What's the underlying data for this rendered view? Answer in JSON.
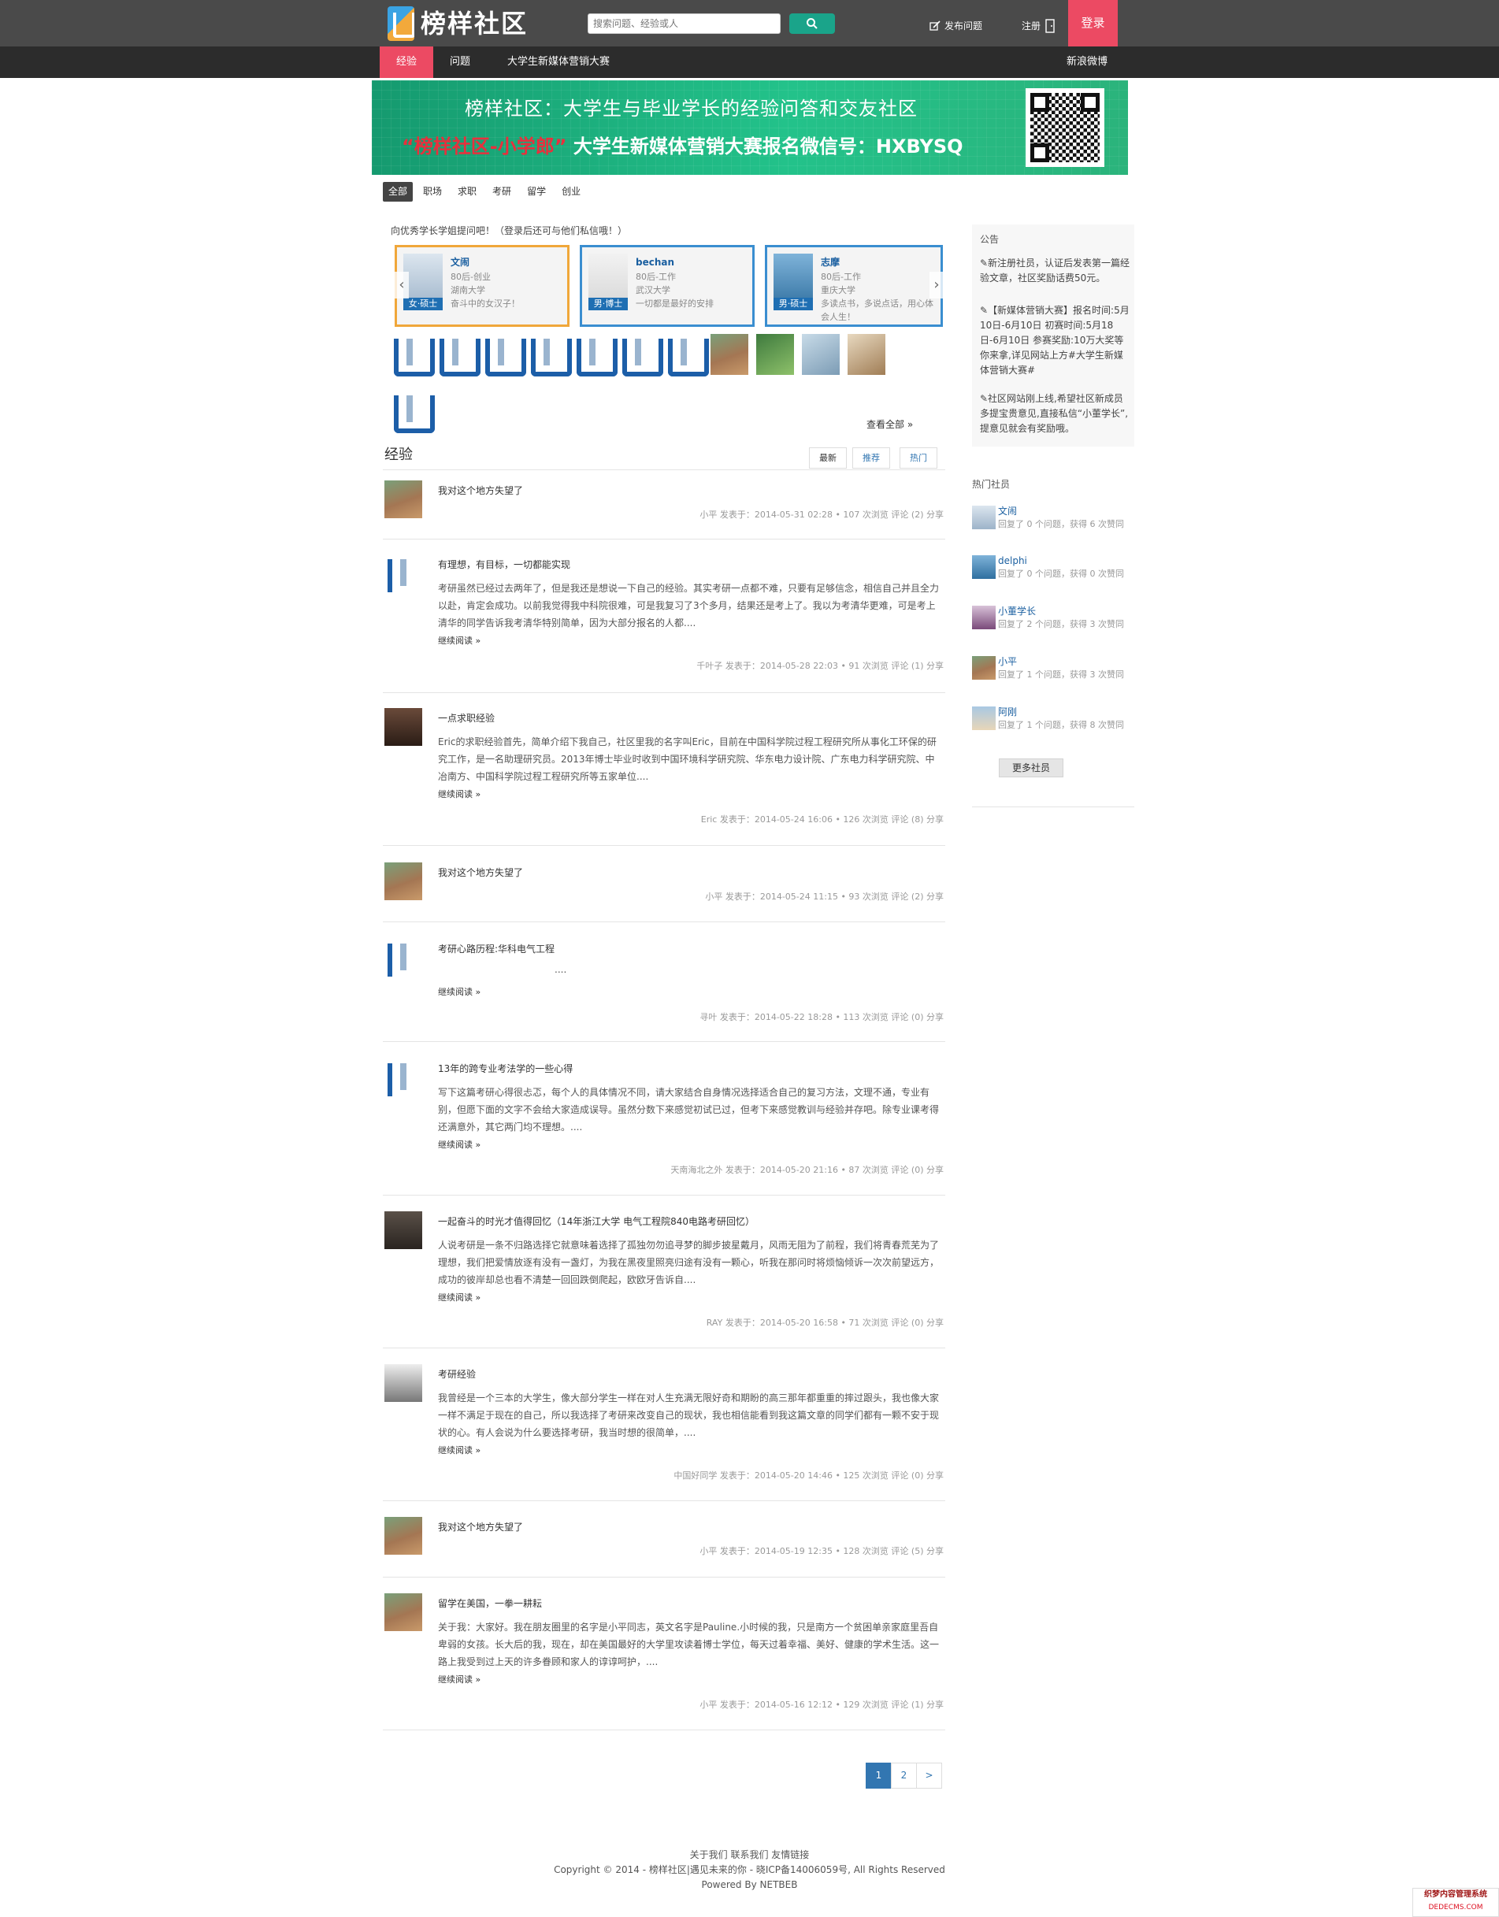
{
  "header": {
    "logo_text": "榜样社区",
    "search_placeholder": "搜索问题、经验或人",
    "ask_label": "发布问题",
    "register_label": "注册",
    "login_label": "登录"
  },
  "nav": {
    "items": [
      "经验",
      "问题",
      "大学生新媒体营销大赛"
    ],
    "right_link": "新浪微博"
  },
  "banner": {
    "line1": "榜样社区：大学生与毕业学长的经验问答和交友社区",
    "line2_red": "“榜样社区-小学郎”",
    "line2_white": "大学生新媒体营销大赛报名微信号：HXBYSQ"
  },
  "categories": [
    "全部",
    "职场",
    "求职",
    "考研",
    "留学",
    "创业"
  ],
  "ask_prompt": "向优秀学长学姐提问吧！（登录后还可与他们私信哦！）",
  "mentors": [
    {
      "name": "文闹",
      "badge": "女·硕士",
      "line1": "80后-创业",
      "line2": "湖南大学",
      "line3": "奋斗中的女汉子！",
      "color": "#f0a73a"
    },
    {
      "name": "bechan",
      "badge": "男·博士",
      "line1": "80后-工作",
      "line2": "武汉大学",
      "line3": "一切都是最好的安排",
      "color": "#3a8ed0"
    },
    {
      "name": "志摩",
      "badge": "男·硕士",
      "line1": "80后-工作",
      "line2": "重庆大学",
      "line3": "多读点书，多说点话，用心体会人生！",
      "color": "#3a8ed0"
    }
  ],
  "view_all": "查看全部 »",
  "section": {
    "title": "经验",
    "tabs": [
      "最新",
      "推荐",
      "热门"
    ]
  },
  "posts": [
    {
      "title": "我对这个地方失望了",
      "excerpt": "",
      "more": "",
      "meta": "小平 发表于：2014-05-31 02:28 • 107 次浏览 评论 (2) 分享"
    },
    {
      "title": "有理想，有目标，一切都能实现",
      "excerpt": "考研虽然已经过去两年了，但是我还是想说一下自己的经验。其实考研一点都不难，只要有足够信念，相信自己并且全力以赴，肯定会成功。以前我觉得我中科院很难，可是我复习了3个多月，结果还是考上了。我以为考清华更难，可是考上清华的同学告诉我考清华特别简单，因为大部分报名的人都....",
      "more": "继续阅读 »",
      "meta": "千叶子 发表于：2014-05-28 22:03 • 91 次浏览 评论 (1) 分享"
    },
    {
      "title": "一点求职经验",
      "excerpt": "Eric的求职经验首先，简单介绍下我自己，社区里我的名字叫Eric，目前在中国科学院过程工程研究所从事化工环保的研究工作，是一名助理研究员。2013年博士毕业时收到中国环境科学研究院、华东电力设计院、广东电力科学研究院、中冶南方、中国科学院过程工程研究所等五家单位....",
      "more": "继续阅读 »",
      "meta": "Eric 发表于：2014-05-24 16:06 • 126 次浏览 评论 (8) 分享"
    },
    {
      "title": "我对这个地方失望了",
      "excerpt": "",
      "more": "",
      "meta": "小平 发表于：2014-05-24 11:15 • 93 次浏览 评论 (2) 分享"
    },
    {
      "title": "考研心路历程:华科电气工程",
      "excerpt": "....",
      "more": "继续阅读 »",
      "meta": "寻叶 发表于：2014-05-22 18:28 • 113 次浏览 评论 (0) 分享"
    },
    {
      "title": "13年的跨专业考法学的一些心得",
      "excerpt": "写下这篇考研心得很忐忑，每个人的具体情况不同，请大家结合自身情况选择适合自己的复习方法，文理不通，专业有别，但愿下面的文字不会给大家造成误导。虽然分数下来感觉初试已过，但考下来感觉教训与经验并存吧。除专业课考得还满意外，其它两门均不理想。....",
      "more": "继续阅读 »",
      "meta": "天南海北之外 发表于：2014-05-20 21:16 • 87 次浏览 评论 (0) 分享"
    },
    {
      "title": "一起奋斗的时光才值得回忆（14年浙江大学 电气工程院840电路考研回忆）",
      "excerpt": "人说考研是一条不归路选择它就意味着选择了孤独勿勿追寻梦的脚步披星戴月，风雨无阻为了前程，我们将青春荒芜为了理想，我们把爱情放逐有没有一盏灯，为我在黑夜里照亮归途有没有一颗心，听我在那问时将烦恼倾诉一次次前望远方，成功的彼岸却总也看不清楚一回回跌倒爬起，欧欧牙告诉自....",
      "more": "继续阅读 »",
      "meta": "RAY 发表于：2014-05-20 16:58 • 71 次浏览 评论 (0) 分享"
    },
    {
      "title": "考研经验",
      "excerpt": "我曾经是一个三本的大学生，像大部分学生一样在对人生充满无限好奇和期盼的高三那年都重重的摔过跟头，我也像大家一样不满足于现在的自己，所以我选择了考研来改变自己的现状，我也相信能看到我这篇文章的同学们都有一颗不安于现状的心。有人会说为什么要选择考研，我当时想的很简单，....",
      "more": "继续阅读 »",
      "meta": "中国好同学 发表于：2014-05-20 14:46 • 125 次浏览 评论 (0) 分享"
    },
    {
      "title": "我对这个地方失望了",
      "excerpt": "",
      "more": "",
      "meta": "小平 发表于：2014-05-19 12:35 • 128 次浏览 评论 (5) 分享"
    },
    {
      "title": "留学在美国，一拳一耕耘",
      "excerpt": "关于我：大家好。我在朋友圈里的名字是小平同志，英文名字是Pauline.小时候的我，只是南方一个贫困单亲家庭里吾自卑弱的女孩。长大后的我，现在，却在美国最好的大学里攻读着博士学位，每天过着幸福、美好、健康的学术生活。这一路上我受到过上天的许多眷顾和家人的谆谆呵护，....",
      "more": "继续阅读 »",
      "meta": "小平 发表于：2014-05-16 12:12 • 129 次浏览 评论 (1) 分享"
    }
  ],
  "pagination": [
    "1",
    "2",
    ">"
  ],
  "sidebar": {
    "notice_title": "公告",
    "notice_p1": "✎新注册社员，认证后发表第一篇经验文章，社区奖励话费50元。",
    "notice_p2": "✎【新媒体营销大赛】报名时间:5月10日-6月10日 初赛时间:5月18日-6月10日 参赛奖励:10万大奖等你来拿,详见网站上方#大学生新媒体营销大赛#",
    "notice_p3": "✎社区网站刚上线,希望社区新成员多提宝贵意见,直接私信“小董学长”,提意见就会有奖励哦。",
    "hot_title": "热门社员",
    "hot_users": [
      {
        "name": "文闹",
        "stat": "回复了 0 个问题，获得 6 次赞同"
      },
      {
        "name": "delphi",
        "stat": "回复了 0 个问题，获得 0 次赞同"
      },
      {
        "name": "小董学长",
        "stat": "回复了 2 个问题，获得 3 次赞同"
      },
      {
        "name": "小平",
        "stat": "回复了 1 个问题，获得 3 次赞同"
      },
      {
        "name": "阿刚",
        "stat": "回复了 1 个问题，获得 8 次赞同"
      }
    ],
    "more_users": "更多社员"
  },
  "footer": {
    "links": "关于我们 联系我们 友情链接",
    "copyright": "Copyright © 2014 - 榜样社区|遇见未来的你 - 晓ICP备14006059号, All Rights Reserved",
    "powered": "Powered By NETBEB"
  },
  "watermark": {
    "line1": "织梦内容管理系统",
    "line2": "DEDECMS.COM"
  },
  "colors": {
    "accent": "#ec4a63",
    "green": "#1aa48a",
    "link_blue": "#3276b1",
    "topbar": "#4a4a4a"
  }
}
